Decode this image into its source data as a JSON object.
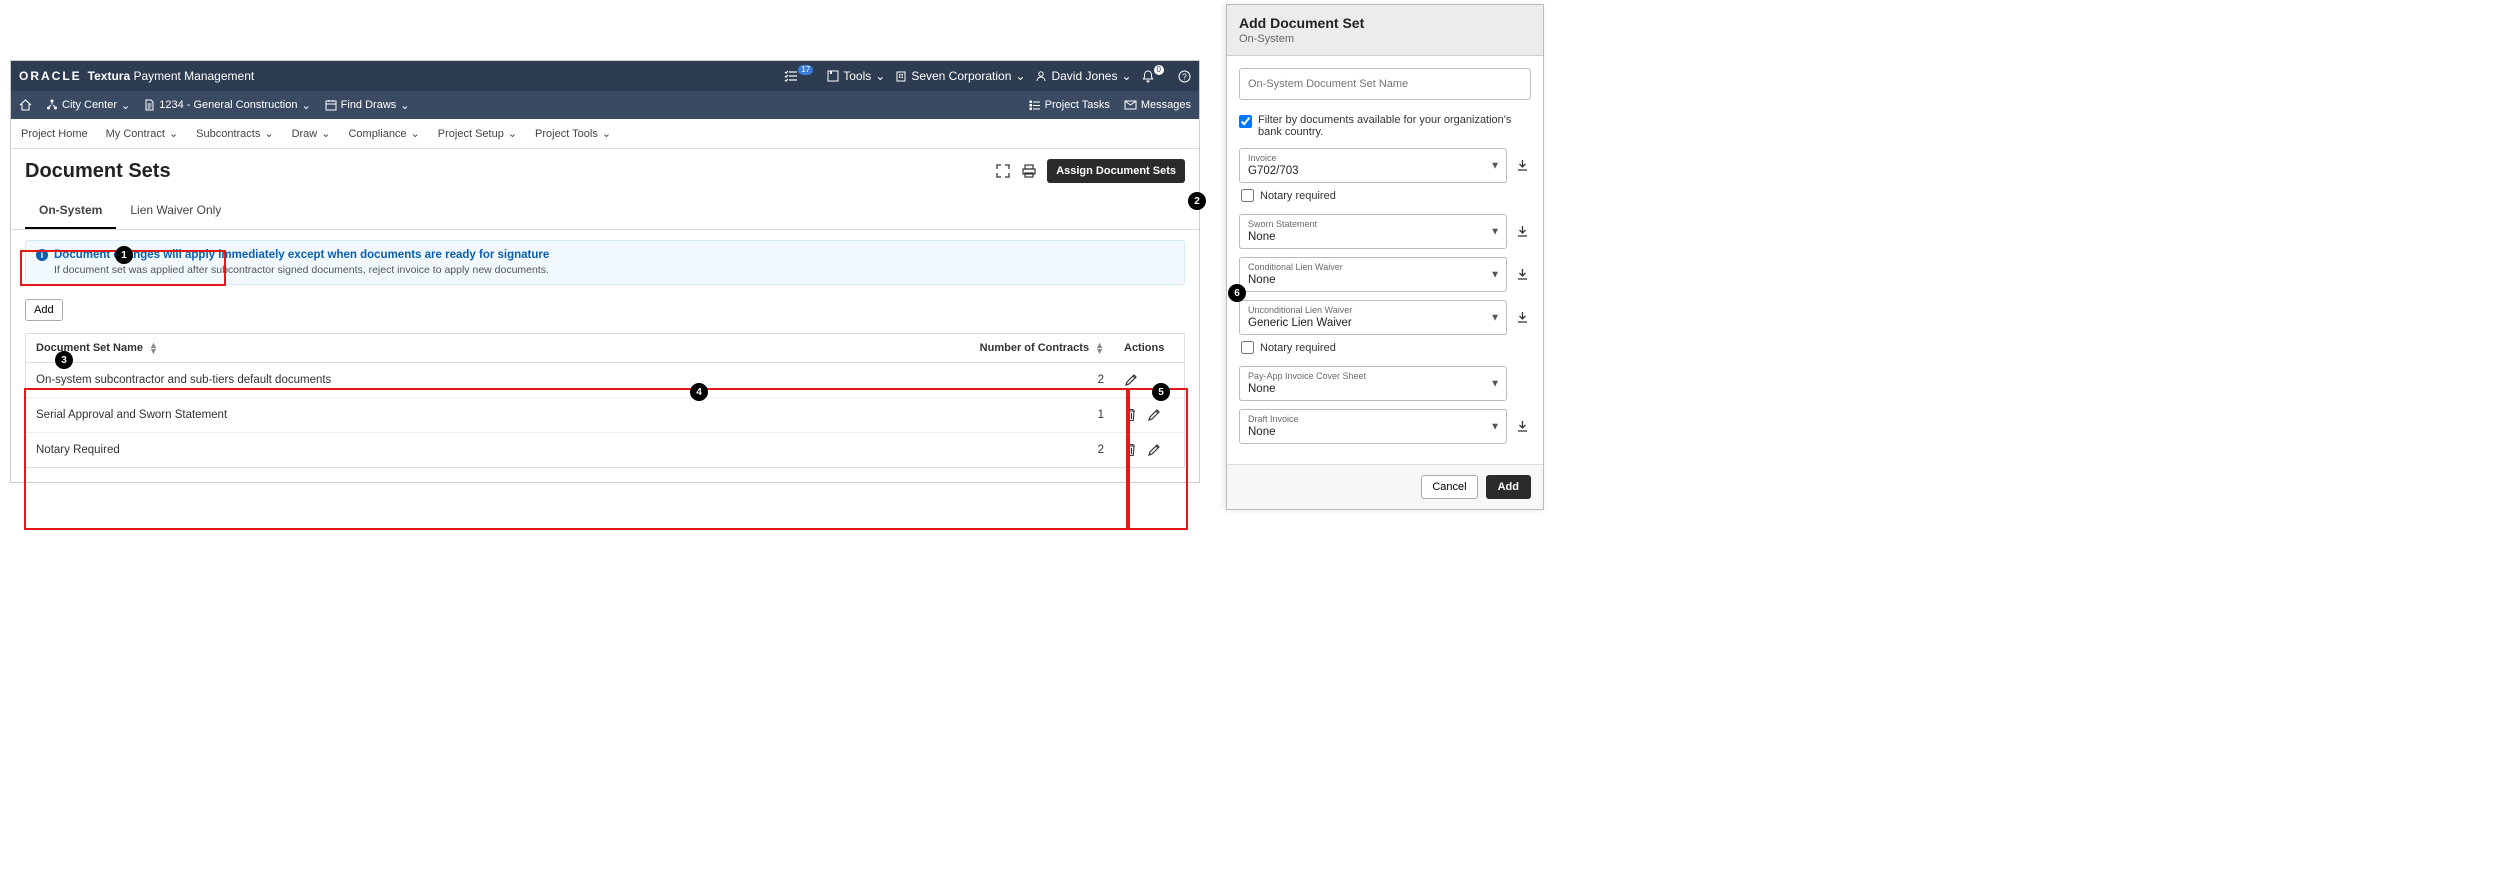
{
  "brand": {
    "logo": "ORACLE",
    "product_bold": "Textura",
    "product_rest": " Payment Management"
  },
  "globalbar": {
    "task_badge": "17",
    "tools": "Tools",
    "org": "Seven Corporation",
    "user": "David Jones",
    "bell_badge": "0"
  },
  "subbar": {
    "project": "City Center",
    "contract": "1234 - General Construction",
    "find_draws": "Find Draws",
    "project_tasks": "Project Tasks",
    "messages": "Messages"
  },
  "menubar": {
    "items": [
      "Project Home",
      "My Contract",
      "Subcontracts",
      "Draw",
      "Compliance",
      "Project Setup",
      "Project Tools"
    ]
  },
  "page": {
    "title": "Document Sets",
    "assign_btn": "Assign Document Sets"
  },
  "tabs": {
    "on_system": "On-System",
    "lien_waiver_only": "Lien Waiver Only"
  },
  "banner": {
    "title": "Document changes will apply immediately except when documents are ready for signature",
    "sub": "If document set was applied after subcontractor signed documents, reject invoice to apply new documents."
  },
  "add_button": "Add",
  "table": {
    "col_name": "Document Set Name",
    "col_num": "Number of Contracts",
    "col_actions": "Actions",
    "rows": [
      {
        "name": "On-system subcontractor and sub-tiers default documents",
        "num": "2",
        "delete": false
      },
      {
        "name": "Serial Approval and Sworn Statement",
        "num": "1",
        "delete": true
      },
      {
        "name": "Notary Required",
        "num": "2",
        "delete": true
      }
    ]
  },
  "drawer": {
    "title": "Add Document Set",
    "subtitle": "On-System",
    "name_placeholder": "On-System Document Set Name",
    "filter_label": "Filter by documents available for your organization's bank country.",
    "selects": [
      {
        "label": "Invoice",
        "value": "G702/703",
        "download": true,
        "notary": true
      },
      {
        "label": "Sworn Statement",
        "value": "None",
        "download": true,
        "notary": false
      },
      {
        "label": "Conditional Lien Waiver",
        "value": "None",
        "download": true,
        "notary": false
      },
      {
        "label": "Unconditional Lien Waiver",
        "value": "Generic Lien Waiver",
        "download": true,
        "notary": true
      },
      {
        "label": "Pay-App Invoice Cover Sheet",
        "value": "None",
        "download": false,
        "notary": false
      },
      {
        "label": "Draft Invoice",
        "value": "None",
        "download": true,
        "notary": false
      }
    ],
    "notary_label": "Notary required",
    "cancel": "Cancel",
    "add": "Add"
  }
}
